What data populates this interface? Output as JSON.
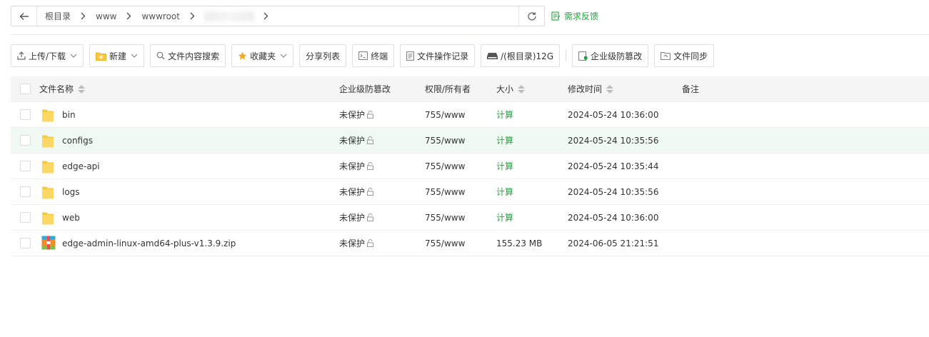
{
  "pathbar": {
    "crumbs": [
      "根目录",
      "www",
      "wwwroot"
    ],
    "feedback_label": "需求反馈"
  },
  "toolbar": {
    "upload": "上传/下载",
    "create": "新建",
    "search": "文件内容搜索",
    "favorites": "收藏夹",
    "share_list": "分享列表",
    "terminal": "终端",
    "op_log": "文件操作记录",
    "disk": "/(根目录)12G",
    "tamper": "企业级防篡改",
    "sync": "文件同步"
  },
  "table": {
    "headers": {
      "name": "文件名称",
      "protect": "企业级防篡改",
      "perm": "权限/所有者",
      "size": "大小",
      "mtime": "修改时间",
      "note": "备注"
    },
    "rows": [
      {
        "name": "bin",
        "type": "folder",
        "protect": "未保护",
        "perm": "755/www",
        "size": "计算",
        "mtime": "2024-05-24 10:36:00",
        "note": ""
      },
      {
        "name": "configs",
        "type": "folder",
        "protect": "未保护",
        "perm": "755/www",
        "size": "计算",
        "mtime": "2024-05-24 10:35:56",
        "note": ""
      },
      {
        "name": "edge-api",
        "type": "folder",
        "protect": "未保护",
        "perm": "755/www",
        "size": "计算",
        "mtime": "2024-05-24 10:35:44",
        "note": ""
      },
      {
        "name": "logs",
        "type": "folder",
        "protect": "未保护",
        "perm": "755/www",
        "size": "计算",
        "mtime": "2024-05-24 10:35:56",
        "note": ""
      },
      {
        "name": "web",
        "type": "folder",
        "protect": "未保护",
        "perm": "755/www",
        "size": "计算",
        "mtime": "2024-05-24 10:36:00",
        "note": ""
      },
      {
        "name": "edge-admin-linux-amd64-plus-v1.3.9.zip",
        "type": "zip",
        "protect": "未保护",
        "perm": "755/www",
        "size": "155.23 MB",
        "mtime": "2024-06-05 21:21:51",
        "note": ""
      }
    ]
  },
  "colors": {
    "accent": "#20a53a",
    "folder": "#f7c948",
    "row_highlight": "#f1f9f4"
  }
}
